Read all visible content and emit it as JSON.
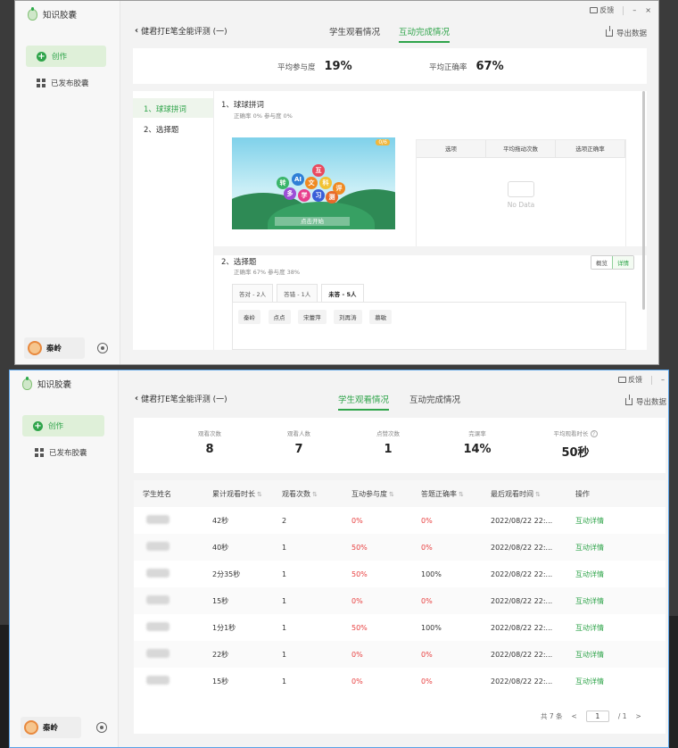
{
  "app": {
    "title": "知识胶囊",
    "feedback": "反馈",
    "minimize": "–",
    "close": "×"
  },
  "sidebar": {
    "create": "创作",
    "published": "已发布胶囊",
    "user_name": "秦岭"
  },
  "header": {
    "back_title": "健君打E笔全能评测 (一)",
    "tab_watch": "学生观看情况",
    "tab_interact": "互动完成情况",
    "export": "导出数据"
  },
  "interact": {
    "avg_participation_label": "平均参与度",
    "avg_participation": "19%",
    "avg_accuracy_label": "平均正确率",
    "avg_accuracy": "67%",
    "questions": [
      {
        "label": "1、球球拼词"
      },
      {
        "label": "2、选择题"
      }
    ],
    "q1": {
      "title": "1、球球拼词",
      "sub": "正确率 0%   参与度 0%",
      "scene_tag": "0/6",
      "scene_button": "点击开始",
      "bubbles": [
        "转",
        "AI",
        "文",
        "互",
        "多",
        "学",
        "科",
        "评",
        "习",
        "测",
        "动"
      ],
      "table_headers": [
        "选项",
        "平均拖动次数",
        "选项正确率"
      ],
      "no_data": "No Data"
    },
    "q2": {
      "title": "2、选择题",
      "sub": "正确率 67%   参与度 38%",
      "view_overview": "概览",
      "view_detail": "详情",
      "answer_tabs": [
        "答对 - 2人",
        "答错 - 1人",
        "未答 - 5人"
      ],
      "names": [
        "秦岭",
        "点点",
        "宋蕾萍",
        "刘再涛",
        "慕敏"
      ]
    }
  },
  "watch": {
    "summary": [
      {
        "label": "观看次数",
        "value": "8"
      },
      {
        "label": "观看人数",
        "value": "7"
      },
      {
        "label": "点赞次数",
        "value": "1"
      },
      {
        "label": "完课率",
        "value": "14%"
      },
      {
        "label": "平均观看时长",
        "value": "50秒"
      }
    ],
    "columns": [
      "学生姓名",
      "累计观看时长",
      "观看次数",
      "互动参与度",
      "答题正确率",
      "最后观看时间",
      "操作"
    ],
    "rows": [
      {
        "duration": "42秒",
        "count": "2",
        "participation": "0%",
        "accuracy": "0%",
        "last": "2022/08/22 22:...",
        "action": "互动详情"
      },
      {
        "duration": "40秒",
        "count": "1",
        "participation": "50%",
        "accuracy": "0%",
        "last": "2022/08/22 22:...",
        "action": "互动详情"
      },
      {
        "duration": "2分35秒",
        "count": "1",
        "participation": "50%",
        "accuracy": "100%",
        "last": "2022/08/22 22:...",
        "action": "互动详情"
      },
      {
        "duration": "15秒",
        "count": "1",
        "participation": "0%",
        "accuracy": "0%",
        "last": "2022/08/22 22:...",
        "action": "互动详情"
      },
      {
        "duration": "1分1秒",
        "count": "1",
        "participation": "50%",
        "accuracy": "100%",
        "last": "2022/08/22 22:...",
        "action": "互动详情"
      },
      {
        "duration": "22秒",
        "count": "1",
        "participation": "0%",
        "accuracy": "0%",
        "last": "2022/08/22 22:...",
        "action": "互动详情"
      },
      {
        "duration": "15秒",
        "count": "1",
        "participation": "0%",
        "accuracy": "0%",
        "last": "2022/08/22 22:...",
        "action": "互动详情"
      }
    ],
    "pager": {
      "total": "共 7 条",
      "prev": "<",
      "page": "1",
      "of": "/ 1",
      "next": ">"
    }
  },
  "colors": {
    "accent": "#2fa44a",
    "danger": "#e84040"
  }
}
